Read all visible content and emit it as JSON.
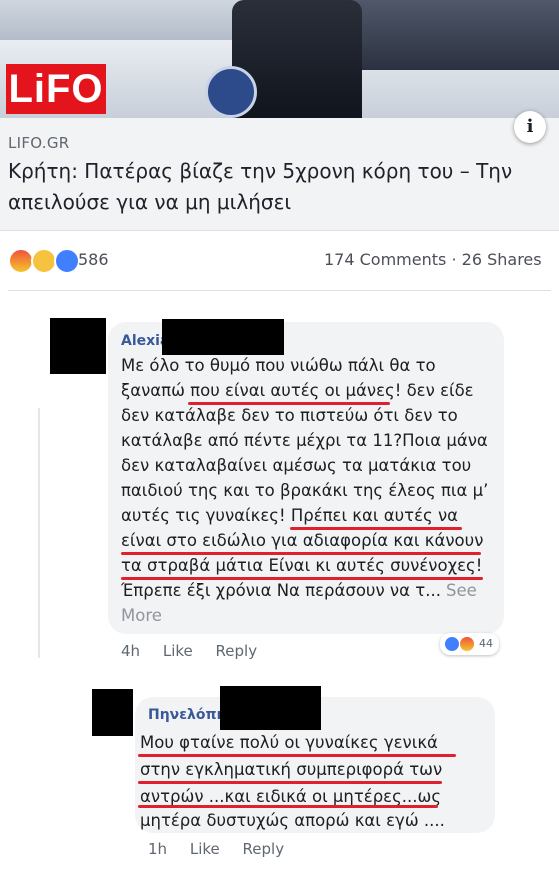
{
  "post": {
    "logo_text": "LiFO",
    "info_icon": "info-icon",
    "domain": "LIFO.GR",
    "headline": "Κρήτη: Πατέρας βίαζε την 5χρονη κόρη του – Την απειλούσε για να μη μιλήσει"
  },
  "reactions": {
    "icons": [
      "angry-icon",
      "sad-icon",
      "like-icon"
    ],
    "count": "586",
    "comments": "174 Comments",
    "shares": "26 Shares",
    "separator": "·"
  },
  "comments": [
    {
      "author": "Alexia",
      "text_lines": [
        "Με όλο το θυμό που νιώθω πάλι θα το",
        "ξαναπώ που είναι αυτές οι μάνες! δεν είδε",
        "δεν κατάλαβε δεν το πιστεύω ότι δεν το",
        "κατάλαβε από πέντε μέχρι τα 11?Ποια μάνα",
        "δεν καταλαβαίνει αμέσως τα ματάκια του",
        "παιδιού της και το βρακάκι της έλεος πια μ’",
        "αυτές τις γυναίκες! Πρέπει και αυτές να",
        "είναι στο ειδώλιο για αδιαφορία και κάνουν",
        "τα στραβά μάτια Είναι κι αυτές συνένοχες!",
        "Έπρεπε έξι χρόνια Να περάσουν να τ..."
      ],
      "see": "See",
      "more": "More",
      "time": "4h",
      "like_label": "Like",
      "reply_label": "Reply",
      "reaction_count": "44"
    },
    {
      "author": "Πηνελόπη",
      "text_lines": [
        "Μου φταίνε πολύ οι γυναίκες γενικά",
        "στην εγκληματική συμπεριφορά των",
        "αντρών ...και ειδικά οι μητέρες...ως",
        "μητέρα δυστυχώς απορώ και εγώ ...."
      ],
      "time": "1h",
      "like_label": "Like",
      "reply_label": "Reply"
    }
  ],
  "colors": {
    "underline": "#e0212d",
    "logo_red": "#e3141b",
    "link_blue": "#385898"
  }
}
